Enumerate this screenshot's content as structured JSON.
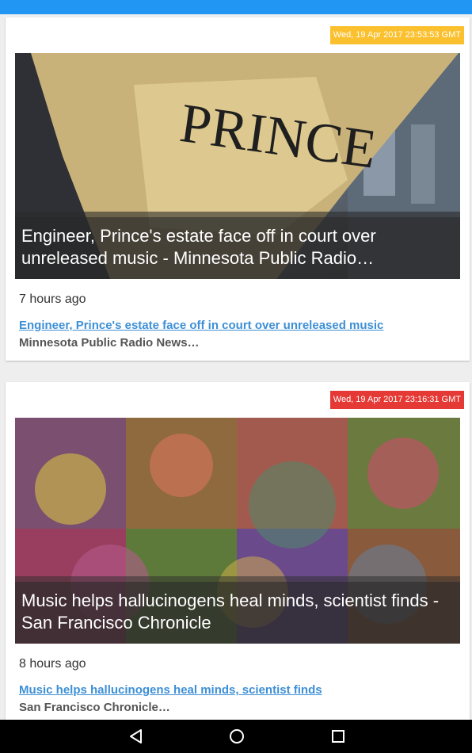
{
  "articles": [
    {
      "timestamp": "Wed, 19 Apr 2017 23:53:53 GMT",
      "timestamp_color": "#fbc02d",
      "image_caption": "Engineer, Prince's estate face off in court over unreleased music - Minnesota Public Radio…",
      "age": "7 hours ago",
      "link_text": "Engineer, Prince's estate face off in court over unreleased music",
      "source": "Minnesota Public Radio News…"
    },
    {
      "timestamp": "Wed, 19 Apr 2017 23:16:31 GMT",
      "timestamp_color": "#e53935",
      "image_caption": "Music helps hallucinogens heal minds, scientist finds - San Francisco Chronicle",
      "age": "8 hours ago",
      "link_text": "Music helps hallucinogens heal minds, scientist finds",
      "source": "San Francisco Chronicle…"
    }
  ],
  "colors": {
    "status_bar": "#2196f3",
    "link": "#3d8fd6",
    "nav_bar": "#000000"
  },
  "nav": {
    "back_icon": "back-triangle-icon",
    "home_icon": "home-circle-icon",
    "recents_icon": "recents-square-icon"
  }
}
